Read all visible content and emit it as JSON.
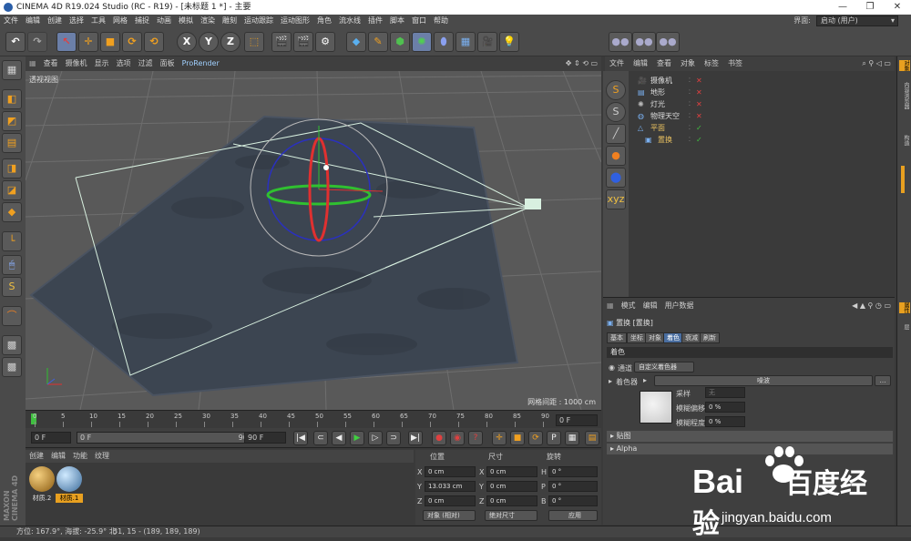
{
  "window": {
    "title": "CINEMA 4D R19.024 Studio (RC - R19) - [未标题 1 *] - 主要",
    "min": "—",
    "max": "❐",
    "close": "✕"
  },
  "menubar": {
    "items": [
      "文件",
      "编辑",
      "创建",
      "选择",
      "工具",
      "网格",
      "捕捉",
      "动画",
      "模拟",
      "渲染",
      "雕刻",
      "运动跟踪",
      "运动图形",
      "角色",
      "流水线",
      "插件",
      "脚本",
      "窗口",
      "帮助"
    ],
    "layout_label": "界面:",
    "layout_value": "启动 (用户)"
  },
  "toolbar": {
    "axis_x": "X",
    "axis_y": "Y",
    "axis_z": "Z"
  },
  "viewport": {
    "menu": [
      "查看",
      "摄像机",
      "显示",
      "选项",
      "过滤",
      "面板",
      "ProRender"
    ],
    "label": "透视视图",
    "grid_info": "网格间距 : 1000 cm",
    "colors": {
      "bg": "#595959",
      "plane": "#3c4551",
      "grid": "#777777"
    }
  },
  "timeline": {
    "ticks": [
      "0",
      "5",
      "10",
      "15",
      "20",
      "25",
      "30",
      "35",
      "40",
      "45",
      "50",
      "55",
      "60",
      "65",
      "70",
      "75",
      "80",
      "85",
      "90"
    ],
    "current_frame": "0 F"
  },
  "transport": {
    "start": "0 F",
    "range_start": "0 F",
    "range_end": "90 F",
    "end": "90 F"
  },
  "materials": {
    "menu": [
      "创建",
      "编辑",
      "功能",
      "纹理"
    ],
    "items": [
      {
        "label": "材质.2",
        "color": "#c08a2a"
      },
      {
        "label": "材质.1",
        "color": "#6aa6d6"
      }
    ]
  },
  "coords": {
    "headers": {
      "position": "位置",
      "size": "尺寸",
      "rotation": "旋转"
    },
    "rows": [
      {
        "axis": "X",
        "pos": "0 cm",
        "saxis": "X",
        "size": "0 cm",
        "raxis": "H",
        "rot": "0 °"
      },
      {
        "axis": "Y",
        "pos": "13.033 cm",
        "saxis": "Y",
        "size": "0 cm",
        "raxis": "P",
        "rot": "0 °"
      },
      {
        "axis": "Z",
        "pos": "0 cm",
        "saxis": "Z",
        "size": "0 cm",
        "raxis": "B",
        "rot": "0 °"
      }
    ],
    "mode": "对象 (相对)",
    "size_mode": "绝对尺寸",
    "apply": "应用"
  },
  "status": {
    "text": "方位: 167.9°, 海拔: -25.9° 北",
    "coords": "31, 15 - (189, 189, 189)"
  },
  "object_manager": {
    "menu": [
      "文件",
      "编辑",
      "查看",
      "对象",
      "标签",
      "书签"
    ],
    "objects": [
      {
        "name": "摄像机",
        "color": "#dddddd",
        "indent": 0
      },
      {
        "name": "地形",
        "color": "#dddddd",
        "indent": 0
      },
      {
        "name": "灯光",
        "color": "#dddddd",
        "indent": 0
      },
      {
        "name": "物理天空",
        "color": "#dddddd",
        "indent": 0
      },
      {
        "name": "平面",
        "color": "#e8c060",
        "indent": 0
      },
      {
        "name": "置换",
        "color": "#e8c060",
        "indent": 1
      }
    ]
  },
  "attribute_manager": {
    "menu": [
      "模式",
      "编辑",
      "用户数据"
    ],
    "object_title": "置换 [置换]",
    "tabs": [
      "基本",
      "坐标",
      "对象",
      "着色",
      "衰减",
      "刷新"
    ],
    "active_tab": "着色",
    "section_title": "着色",
    "channel_label": "通道",
    "channel_value": "自定义着色器",
    "shader_label": "着色器",
    "shader_value": "噪波",
    "sampling_label": "采样",
    "sampling_value": "无",
    "blur_offset_label": "模糊偏移",
    "blur_offset_value": "0 %",
    "blur_scale_label": "模糊程度",
    "blur_scale_value": "0 %",
    "section_mapping": "贴图",
    "section_alpha": "Alpha"
  },
  "right_tabs": [
    "对象",
    "内容浏览器",
    "构造",
    "属性",
    "层"
  ],
  "watermark": {
    "brand_a": "Bai",
    "brand_b": "百度",
    "brand_c": "经验",
    "url": "jingyan.baidu.com"
  },
  "brand_vertical": "MAXON CINEMA 4D"
}
